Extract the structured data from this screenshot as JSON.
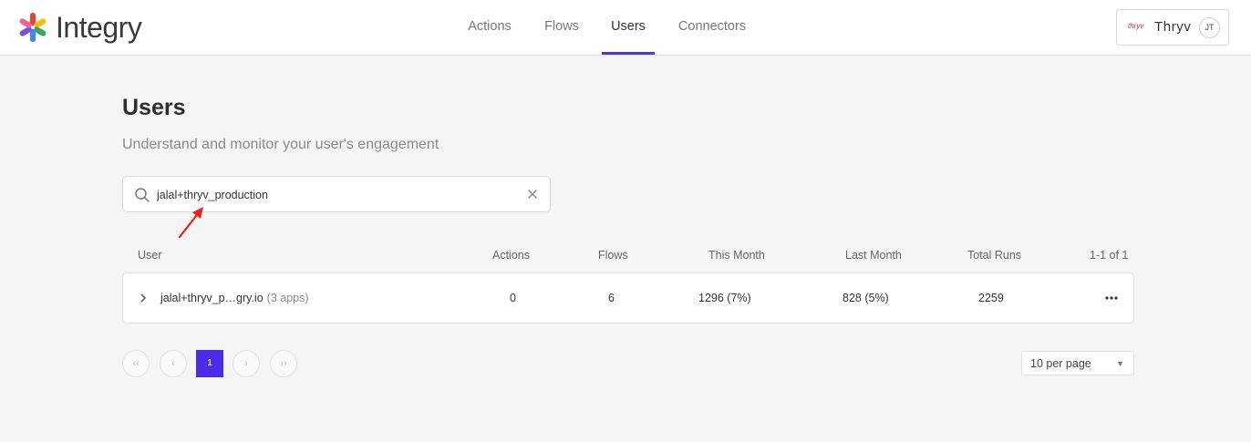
{
  "brand": {
    "name": "Integry"
  },
  "nav": {
    "items": [
      {
        "label": "Actions"
      },
      {
        "label": "Flows"
      },
      {
        "label": "Users"
      },
      {
        "label": "Connectors"
      }
    ],
    "active": "Users",
    "accent_color": "#4c35e6"
  },
  "account": {
    "logo_text": "thryv",
    "name": "Thryv",
    "initials": "JT"
  },
  "page": {
    "title": "Users",
    "subtitle": "Understand and monitor your user's engagement"
  },
  "search": {
    "value": "jalal+thryv_production",
    "icon": "search-icon",
    "clear_icon": "close-icon"
  },
  "table": {
    "columns": [
      "User",
      "Actions",
      "Flows",
      "This Month",
      "Last Month",
      "Total Runs"
    ],
    "range": "1-1 of 1",
    "rows": [
      {
        "user": "jalal+thryv_p…gry.io",
        "apps": "(3 apps)",
        "actions": "0",
        "flows": "6",
        "this_month": "1296 (7%)",
        "last_month": "828 (5%)",
        "total_runs": "2259"
      }
    ]
  },
  "pagination": {
    "first": "‹‹",
    "prev": "‹",
    "current": "1",
    "next": "›",
    "last": "››",
    "per_page": "10 per page",
    "current_color": "#4c2ce6"
  },
  "annotation": {
    "arrow_color": "#e8231a"
  }
}
